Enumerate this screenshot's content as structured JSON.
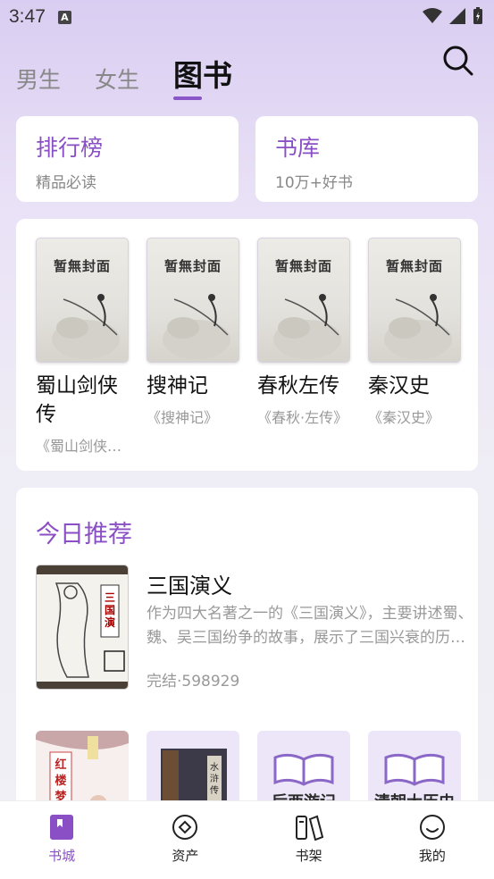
{
  "status": {
    "time": "3:47",
    "notification_letter": "A"
  },
  "top_tabs": [
    {
      "label": "男生"
    },
    {
      "label": "女生"
    },
    {
      "label": "图书"
    }
  ],
  "quick_entries": [
    {
      "title": "排行榜",
      "subtitle": "精品必读"
    },
    {
      "title": "书库",
      "subtitle": "10万+好书"
    }
  ],
  "featured_books": [
    {
      "cover_text": "暂無封面",
      "title": "蜀山剑侠传",
      "desc": "《蜀山剑侠传》"
    },
    {
      "cover_text": "暂無封面",
      "title": "搜神记",
      "desc": "《搜神记》"
    },
    {
      "cover_text": "暂無封面",
      "title": "春秋左传",
      "desc": "《春秋·左传》"
    },
    {
      "cover_text": "暂無封面",
      "title": "秦汉史",
      "desc": "《秦汉史》"
    }
  ],
  "recommend": {
    "heading": "今日推荐",
    "book": {
      "title": "三国演义",
      "intro": "作为四大名著之一的《三国演义》，主要讲述蜀、魏、吴三国纷争的故事，展示了三国兴衰的历史。",
      "meta": "完结·598929",
      "cover_text": "三国演义"
    },
    "more_books": [
      {
        "cover_text": "红楼梦"
      },
      {
        "cover_text": "水浒传"
      },
      {
        "cover_text": "后西游记"
      },
      {
        "cover_text": "清朝大历史"
      }
    ]
  },
  "bottom_nav": [
    {
      "label": "书城"
    },
    {
      "label": "资产"
    },
    {
      "label": "书架"
    },
    {
      "label": "我的"
    }
  ],
  "colors": {
    "accent": "#8a4fc4",
    "muted": "#999999"
  }
}
